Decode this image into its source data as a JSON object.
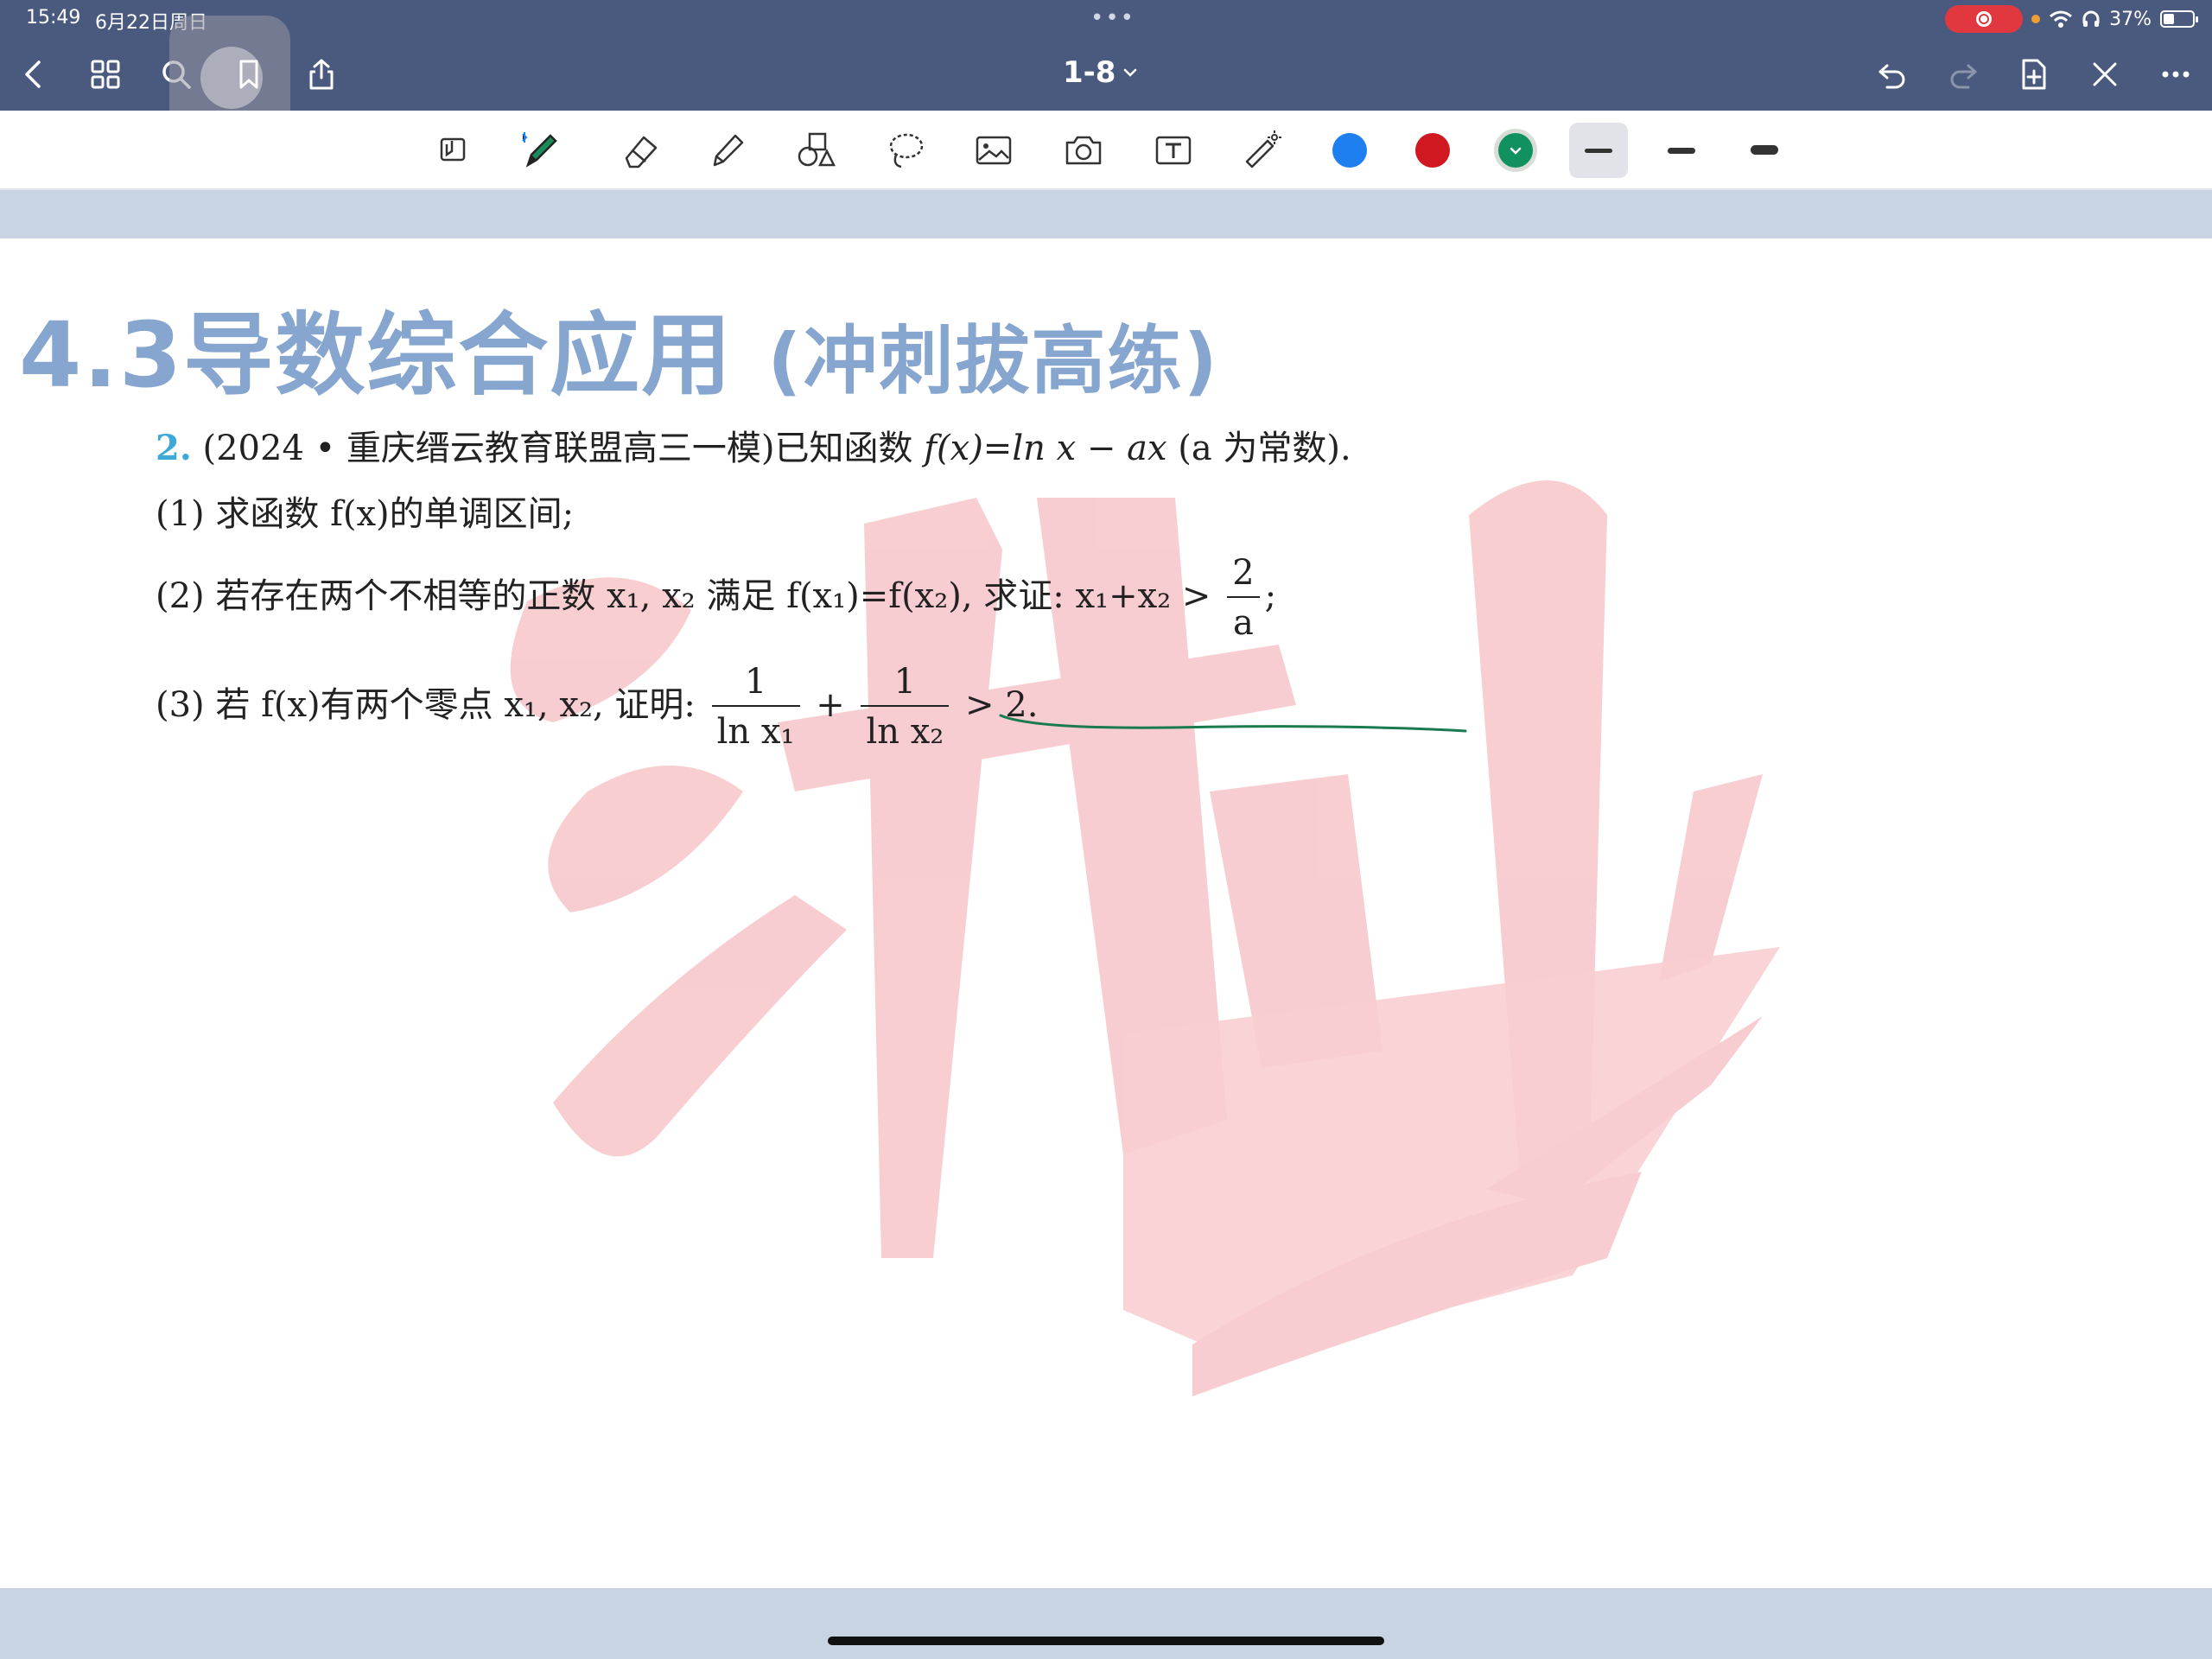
{
  "status": {
    "time": "15:49",
    "date": "6月22日周日",
    "battery": "37%"
  },
  "nav": {
    "doc_title": "1-8"
  },
  "toolbar": {
    "colors": {
      "blue": "#1e7ff0",
      "red": "#d01820",
      "green": "#119060"
    }
  },
  "page": {
    "heading_main": "4.3导数综合应用",
    "heading_sub": "(冲刺拔高练)",
    "q_num": "2.",
    "q_intro": "(2024 • 重庆缙云教育联盟高三一模)已知函数 ",
    "q_func": "f(x)=ln x − ax",
    "q_tail": " (a 为常数).",
    "p1": "(1) 求函数 f(x)的单调区间;",
    "p2_text": "(2) 若存在两个不相等的正数 x₁, x₂ 满足 f(x₁)=f(x₂), 求证: x₁+x₂ >",
    "p2_num": "2",
    "p2_den": "a",
    "p2_end": ";",
    "p3_text": "(3) 若 f(x)有两个零点 x₁, x₂, 证明:",
    "p3_f1_num": "1",
    "p3_f1_den": "ln x₁",
    "p3_plus": "+",
    "p3_f2_num": "1",
    "p3_f2_den": "ln x₂",
    "p3_end": "> 2."
  }
}
